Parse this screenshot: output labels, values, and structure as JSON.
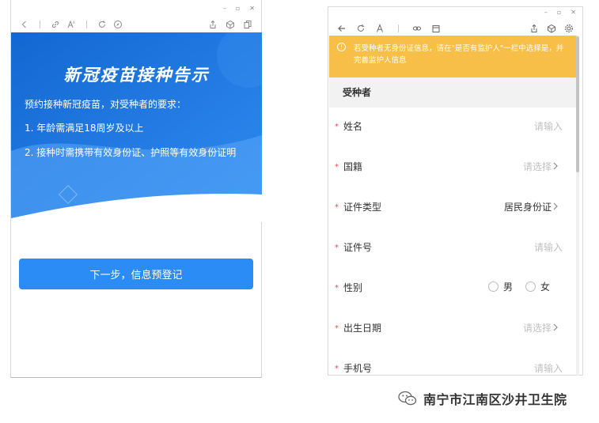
{
  "left_window": {
    "banner": {
      "title": "新冠疫苗接种告示",
      "intro": "预约接种新冠疫苗，对受种者的要求：",
      "requirements": [
        "1. 年龄需满足18周岁及以上",
        "2. 接种时需携带有效身份证、护照等有效身份证明"
      ]
    },
    "next_button_label": "下一步，信息预登记"
  },
  "right_window": {
    "warning_text": "若受种者无身份证信息，请在\"是否有监护人\"一栏中选择是，并完善监护人信息",
    "section_title": "受种者",
    "fields": [
      {
        "label": "姓名",
        "value": "请输入",
        "filled": false,
        "arrow": false
      },
      {
        "label": "国籍",
        "value": "请选择",
        "filled": false,
        "arrow": true
      },
      {
        "label": "证件类型",
        "value": "居民身份证",
        "filled": true,
        "arrow": true
      },
      {
        "label": "证件号",
        "value": "请输入",
        "filled": false,
        "arrow": false
      },
      {
        "label": "性别",
        "options": [
          "男",
          "女"
        ]
      },
      {
        "label": "出生日期",
        "value": "请选择",
        "filled": false,
        "arrow": true
      },
      {
        "label": "手机号",
        "value": "请输入",
        "filled": false,
        "arrow": false
      }
    ]
  },
  "watermark": {
    "text": "南宁市江南区沙井卫生院"
  },
  "colors": {
    "banner_blue": "#1a6fd8",
    "button_blue": "#2a8cf4",
    "warning_yellow": "#f7bf47",
    "required_red": "#e84b4b"
  }
}
